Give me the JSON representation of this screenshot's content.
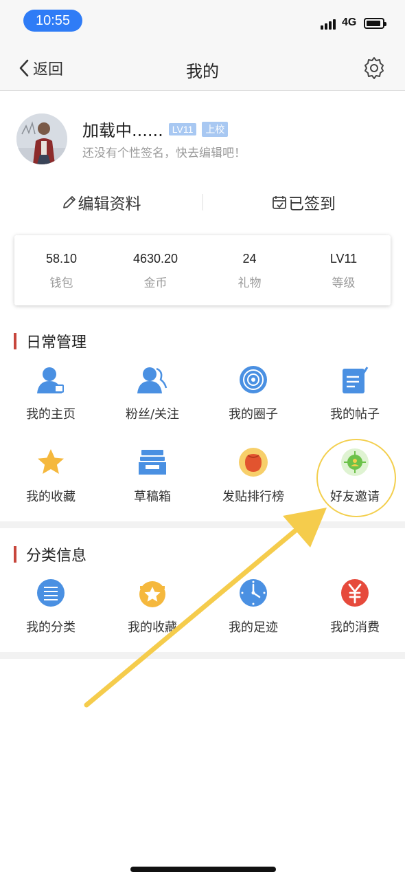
{
  "status_bar": {
    "time": "10:55",
    "network": "4G"
  },
  "nav": {
    "back_label": "返回",
    "title": "我的"
  },
  "profile": {
    "name": "加载中......",
    "level_badge": "LV11",
    "rank_badge": "上校",
    "signature": "还没有个性签名，快去编辑吧！"
  },
  "actions": {
    "edit_label": "编辑资料",
    "checkin_label": "已签到"
  },
  "stats": [
    {
      "value": "58.10",
      "label": "钱包"
    },
    {
      "value": "4630.20",
      "label": "金币"
    },
    {
      "value": "24",
      "label": "礼物"
    },
    {
      "value": "LV11",
      "label": "等级"
    }
  ],
  "daily": {
    "title": "日常管理",
    "items": [
      {
        "label": "我的主页",
        "icon": "user-profile-icon"
      },
      {
        "label": "粉丝/关注",
        "icon": "fans-icon"
      },
      {
        "label": "我的圈子",
        "icon": "circle-target-icon"
      },
      {
        "label": "我的帖子",
        "icon": "post-edit-icon"
      },
      {
        "label": "我的收藏",
        "icon": "star-icon"
      },
      {
        "label": "草稿箱",
        "icon": "drafts-tray-icon"
      },
      {
        "label": "发贴排行榜",
        "icon": "ranking-bag-icon"
      },
      {
        "label": "好友邀请",
        "icon": "invite-friend-icon"
      }
    ]
  },
  "category": {
    "title": "分类信息",
    "items": [
      {
        "label": "我的分类",
        "icon": "list-icon"
      },
      {
        "label": "我的收藏",
        "icon": "star-badge-icon"
      },
      {
        "label": "我的足迹",
        "icon": "clock-icon"
      },
      {
        "label": "我的消费",
        "icon": "yuan-icon"
      }
    ]
  },
  "colors": {
    "accent_blue": "#2f7cf6",
    "icon_blue": "#4a90e2",
    "section_marker": "#c7463c",
    "highlight_yellow": "#f3cf4e"
  }
}
